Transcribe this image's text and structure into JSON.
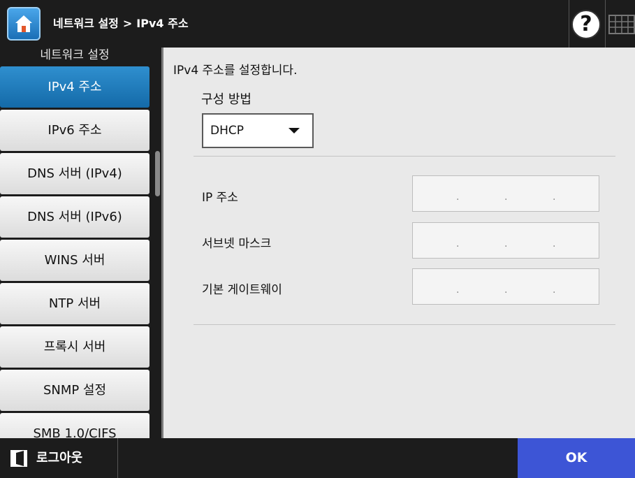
{
  "header": {
    "breadcrumb_parent": "네트워크 설정",
    "breadcrumb_separator": ">",
    "breadcrumb_current": "IPv4 주소",
    "help_label": "?",
    "icons": [
      "home-icon",
      "help-icon",
      "keyboard-icon"
    ]
  },
  "sidebar": {
    "title": "네트워크 설정",
    "items": [
      {
        "label": "IPv4 주소",
        "active": true
      },
      {
        "label": "IPv6 주소"
      },
      {
        "label": "DNS 서버 (IPv4)"
      },
      {
        "label": "DNS 서버 (IPv6)"
      },
      {
        "label": "WINS 서버"
      },
      {
        "label": "NTP 서버"
      },
      {
        "label": "프록시 서버"
      },
      {
        "label": "SNMP 설정"
      },
      {
        "label": "SMB 1.0/CIFS"
      }
    ]
  },
  "main": {
    "description": "IPv4 주소를 설정합니다.",
    "method_label": "구성 방법",
    "method_value": "DHCP",
    "fields": [
      {
        "label": "IP 주소",
        "value": ""
      },
      {
        "label": "서브넷 마스크",
        "value": ""
      },
      {
        "label": "기본 게이트웨이",
        "value": ""
      }
    ]
  },
  "footer": {
    "logout_label": "로그아웃",
    "ok_label": "OK"
  },
  "colors": {
    "active_nav": "#1f7ec0",
    "ok_button": "#3d55d6",
    "header_bg": "#1c1c1c",
    "content_bg": "#e9e9e9"
  }
}
